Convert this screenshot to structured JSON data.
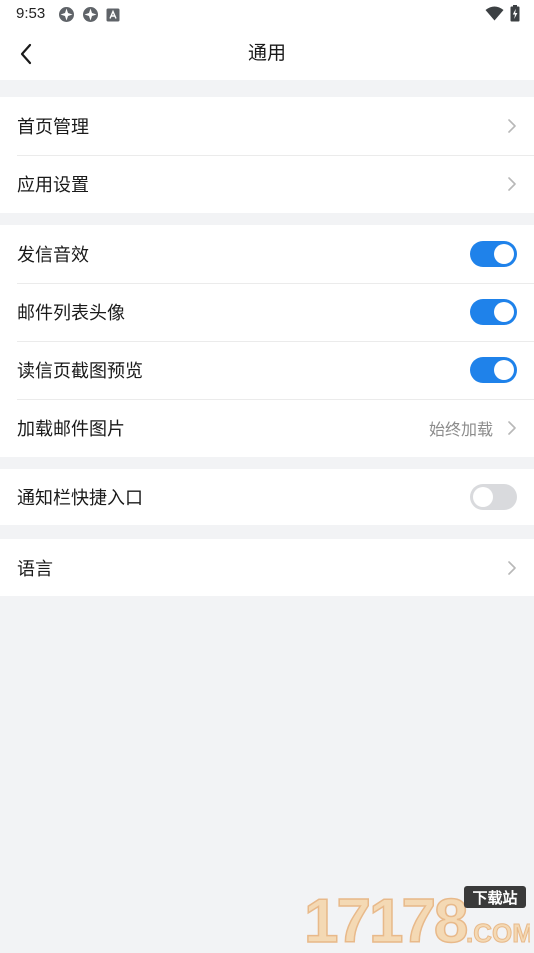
{
  "status_bar": {
    "time": "9:53",
    "left_icons": [
      "app-notification-icon",
      "app-notification-icon",
      "text-notification-icon"
    ],
    "right_icons": [
      "wifi-icon",
      "battery-charging-icon"
    ]
  },
  "header": {
    "title": "通用",
    "back_icon": "back-chevron-icon"
  },
  "groups": [
    {
      "rows": [
        {
          "label": "首页管理",
          "control": "chevron"
        },
        {
          "label": "应用设置",
          "control": "chevron"
        }
      ]
    },
    {
      "rows": [
        {
          "label": "发信音效",
          "control": "toggle",
          "state": "on"
        },
        {
          "label": "邮件列表头像",
          "control": "toggle",
          "state": "on"
        },
        {
          "label": "读信页截图预览",
          "control": "toggle",
          "state": "on"
        },
        {
          "label": "加载邮件图片",
          "control": "chevron",
          "value": "始终加载"
        }
      ]
    },
    {
      "rows": [
        {
          "label": "通知栏快捷入口",
          "control": "toggle",
          "state": "off"
        }
      ]
    },
    {
      "rows": [
        {
          "label": "语言",
          "control": "chevron"
        }
      ]
    }
  ],
  "watermark": {
    "number": "17178",
    "badge": "下载站",
    "suffix": ".COM"
  },
  "colors": {
    "accent": "#1f82ea",
    "toggle_off": "#d9dadd",
    "background": "#f2f3f5",
    "surface": "#ffffff"
  }
}
